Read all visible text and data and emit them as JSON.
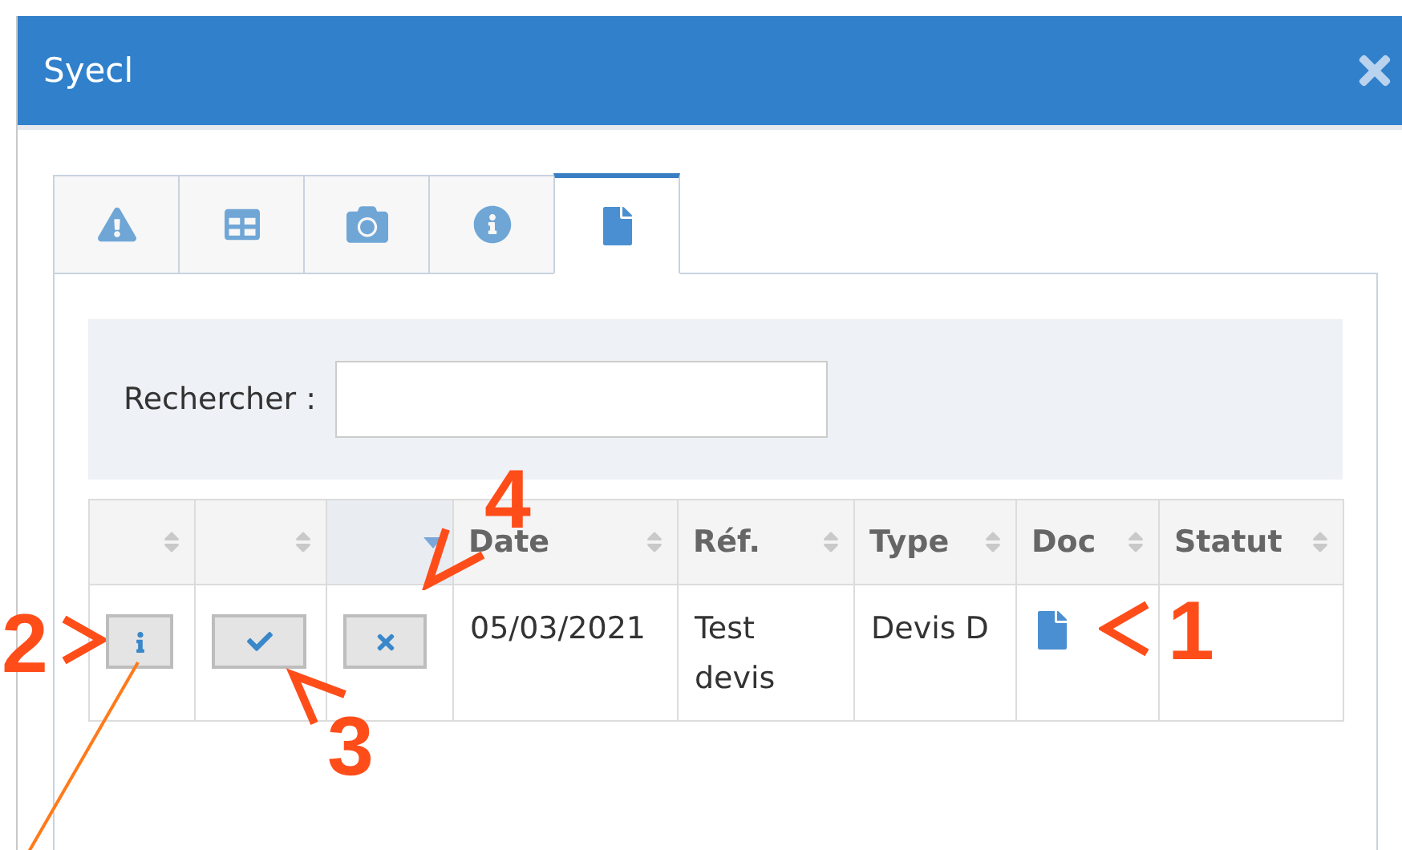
{
  "window": {
    "title": "Syecl"
  },
  "tabs": [
    {
      "kind": "warning",
      "selected": false
    },
    {
      "kind": "table",
      "selected": false
    },
    {
      "kind": "camera",
      "selected": false
    },
    {
      "kind": "info",
      "selected": false
    },
    {
      "kind": "file",
      "selected": true
    }
  ],
  "search": {
    "label": "Rechercher :"
  },
  "table": {
    "columns": [
      {
        "sorted": false
      },
      {
        "sorted": false
      },
      {
        "sorted": true
      },
      {
        "label": "Date",
        "sorted": false
      },
      {
        "label": "Réf.",
        "sorted": false
      },
      {
        "label": "Type",
        "sorted": false
      },
      {
        "label": "Doc",
        "sorted": false
      },
      {
        "label": "Statut",
        "sorted": false
      }
    ],
    "rows": [
      {
        "cells": [
          {
            "kind": "info-button"
          },
          {
            "kind": "check-button"
          },
          {
            "kind": "cross-button"
          },
          {
            "kind": "text",
            "text": "05/03/2021"
          },
          {
            "kind": "text",
            "text": "Test devis"
          },
          {
            "kind": "text",
            "text": "Devis D"
          },
          {
            "kind": "document"
          },
          {
            "kind": "blank"
          }
        ]
      }
    ]
  },
  "annotations": [
    {
      "label": "1",
      "kind": "left"
    },
    {
      "label": "2",
      "kind": "right"
    },
    {
      "label": "3",
      "kind": "upleft"
    },
    {
      "label": "4",
      "kind": "downleft"
    }
  ]
}
